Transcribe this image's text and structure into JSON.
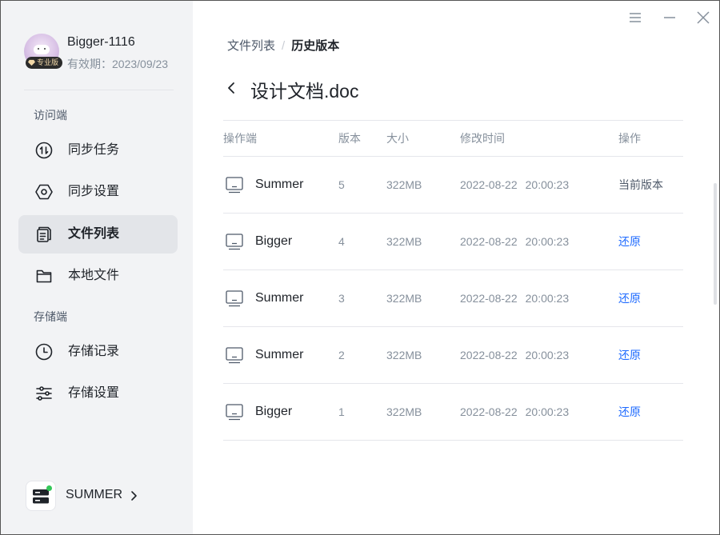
{
  "profile": {
    "username": "Bigger-1116",
    "expire_text": "有效期：2023/09/23",
    "badge": "专业版"
  },
  "sidebar": {
    "section_access": "访问端",
    "section_storage": "存储端",
    "items": [
      {
        "label": "同步任务",
        "icon": "sync-icon"
      },
      {
        "label": "同步设置",
        "icon": "hexagon-settings-icon"
      },
      {
        "label": "文件列表",
        "icon": "file-list-icon",
        "active": true
      },
      {
        "label": "本地文件",
        "icon": "folder-icon"
      },
      {
        "label": "存储记录",
        "icon": "clock-icon"
      },
      {
        "label": "存储设置",
        "icon": "sliders-icon"
      }
    ],
    "device": {
      "name": "SUMMER",
      "status_color": "#34c759"
    }
  },
  "breadcrumb": {
    "parent": "文件列表",
    "separator": "/",
    "current": "历史版本"
  },
  "file": {
    "title": "设计文档.doc"
  },
  "table": {
    "headers": {
      "client": "操作端",
      "version": "版本",
      "size": "大小",
      "modified": "修改时间",
      "action": "操作"
    },
    "rows": [
      {
        "client": "Summer",
        "version": "5",
        "size": "322MB",
        "date": "2022-08-22",
        "time": "20:00:23",
        "action": "当前版本"
      },
      {
        "client": "Bigger",
        "version": "4",
        "size": "322MB",
        "date": "2022-08-22",
        "time": "20:00:23",
        "action": "还原"
      },
      {
        "client": "Summer",
        "version": "3",
        "size": "322MB",
        "date": "2022-08-22",
        "time": "20:00:23",
        "action": "还原"
      },
      {
        "client": "Summer",
        "version": "2",
        "size": "322MB",
        "date": "2022-08-22",
        "time": "20:00:23",
        "action": "还原"
      },
      {
        "client": "Bigger",
        "version": "1",
        "size": "322MB",
        "date": "2022-08-22",
        "time": "20:00:23",
        "action": "还原"
      }
    ]
  },
  "colors": {
    "accent": "#1f6bff",
    "sidebar_bg": "#f2f3f5",
    "active_item_bg": "#e3e5e9"
  }
}
